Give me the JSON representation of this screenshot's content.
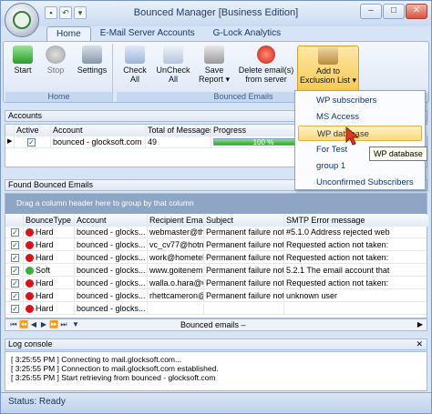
{
  "window": {
    "title": "Bounced Manager [Business Edition]",
    "controls": [
      "–",
      "□",
      "✕"
    ]
  },
  "tabs": [
    {
      "label": "Home",
      "active": true
    },
    {
      "label": "E-Mail Server Accounts",
      "active": false
    },
    {
      "label": "G-Lock Analytics",
      "active": false
    }
  ],
  "ribbon": {
    "home_group": {
      "label": "Home",
      "buttons": [
        "Start",
        "Stop",
        "Settings"
      ]
    },
    "bounced_group": {
      "label": "Bounced Emails",
      "buttons": [
        {
          "line1": "Check",
          "line2": "All"
        },
        {
          "line1": "UnCheck",
          "line2": "All"
        },
        {
          "line1": "Save",
          "line2": "Report ▾"
        },
        {
          "line1": "Delete email(s)",
          "line2": "from server"
        },
        {
          "line1": "Add to",
          "line2": "Exclusion List ▾"
        }
      ]
    }
  },
  "accounts": {
    "title": "Accounts",
    "headers": [
      "Active",
      "Account",
      "Total of Messages",
      "Progress"
    ],
    "rows": [
      {
        "account": "bounced - glocksoft.com",
        "total": "49",
        "progress_text": "100 %",
        "progress": 1.0
      }
    ]
  },
  "found": {
    "title": "Found Bounced Emails",
    "group_hint": "Drag a column header here to group by that column",
    "headers": [
      "BounceType",
      "Account",
      "Recipient Email...",
      "Subject",
      "SMTP Error message"
    ],
    "rows": [
      {
        "type": "Hard",
        "account": "bounced - glocks...",
        "email": "webmaster@th...",
        "subject": "Permanent failure notice",
        "error": "#5.1.0 Address rejected web"
      },
      {
        "type": "Hard",
        "account": "bounced - glocks...",
        "email": "vc_cv77@hotm...",
        "subject": "Permanent failure notice",
        "error": "Requested action not taken:"
      },
      {
        "type": "Hard",
        "account": "bounced - glocks...",
        "email": "work@hometeh...",
        "subject": "Permanent failure notice",
        "error": "Requested action not taken:"
      },
      {
        "type": "Soft",
        "account": "bounced - glocks...",
        "email": "www.goitenem...",
        "subject": "Permanent failure notice",
        "error": "5.2.1 The email account that"
      },
      {
        "type": "Hard",
        "account": "bounced - glocks...",
        "email": "walla.o.hara@w...",
        "subject": "Permanent failure notice",
        "error": "Requested action not taken:"
      },
      {
        "type": "Hard",
        "account": "bounced - glocks...",
        "email": "rhettcameron@...",
        "subject": "Permanent failure notice",
        "error": "unknown user"
      },
      {
        "type": "Hard",
        "account": "bounced - glocks...",
        "email": "",
        "subject": "",
        "error": ""
      }
    ],
    "footer_label": "Bounced emails –"
  },
  "log": {
    "title": "Log console",
    "lines": [
      "[ 3:25:55 PM ] Connecting to mail.glocksoft.com...",
      "[ 3:25:55 PM ] Connection to mail.glocksoft.com established.",
      "[ 3:25:55 PM ] Start retrieving from bounced - glocksoft.com"
    ]
  },
  "status": {
    "text": "Status: Ready"
  },
  "menu": {
    "items": [
      "WP subscribers",
      "MS Access",
      "WP database",
      "For Test",
      "group 1",
      "Unconfirmed Subscribers"
    ],
    "selected": 2
  },
  "tooltip": {
    "text": "WP database"
  },
  "colors": {
    "hard": "#d8141a",
    "soft": "#36b336",
    "accent": "#1f3c68"
  }
}
